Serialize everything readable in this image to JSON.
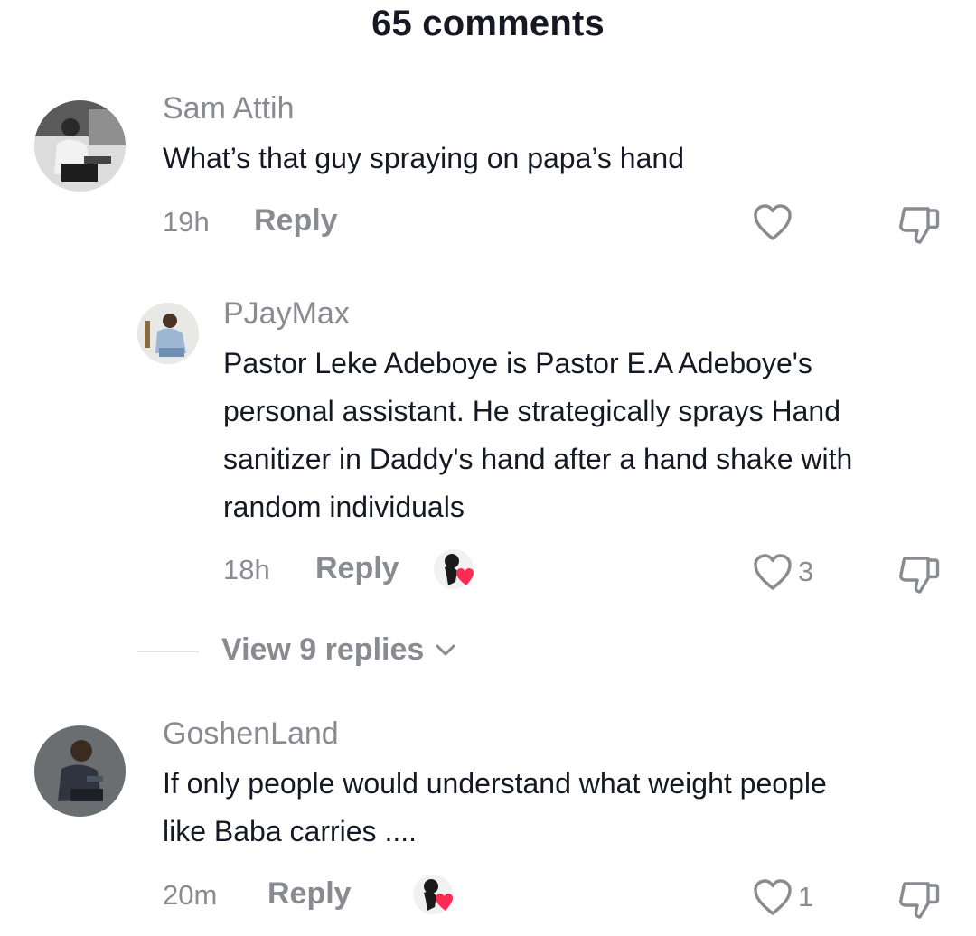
{
  "header": {
    "title": "65 comments"
  },
  "comments": [
    {
      "username": "Sam Attih",
      "lines": [
        "What’s that guy spraying on papa’s hand"
      ],
      "time": "19h",
      "reply_label": "Reply",
      "likes": "",
      "creator_liked": false
    },
    {
      "username": "PJayMax",
      "lines": [
        "Pastor Leke Adeboye is Pastor E.A Adeboye's",
        "personal assistant. He strategically sprays Hand",
        "sanitizer in Daddy's hand after a hand shake with",
        "random individuals"
      ],
      "time": "18h",
      "reply_label": "Reply",
      "likes": "3",
      "creator_liked": true
    },
    {
      "username": "GoshenLand",
      "lines": [
        "If only people would understand what weight people",
        "like Baba carries ...."
      ],
      "time": "20m",
      "reply_label": "Reply",
      "likes": "1",
      "creator_liked": true
    }
  ],
  "view_replies": {
    "label": "View 9 replies"
  },
  "icons": {
    "like": "heart-outline-icon",
    "dislike": "thumbs-down-icon",
    "creator_like": "creator-liked-heart-icon",
    "expand": "chevron-down-icon"
  },
  "colors": {
    "muted": "#8a8b91",
    "text": "#161823",
    "heart": "#fe2c55"
  }
}
